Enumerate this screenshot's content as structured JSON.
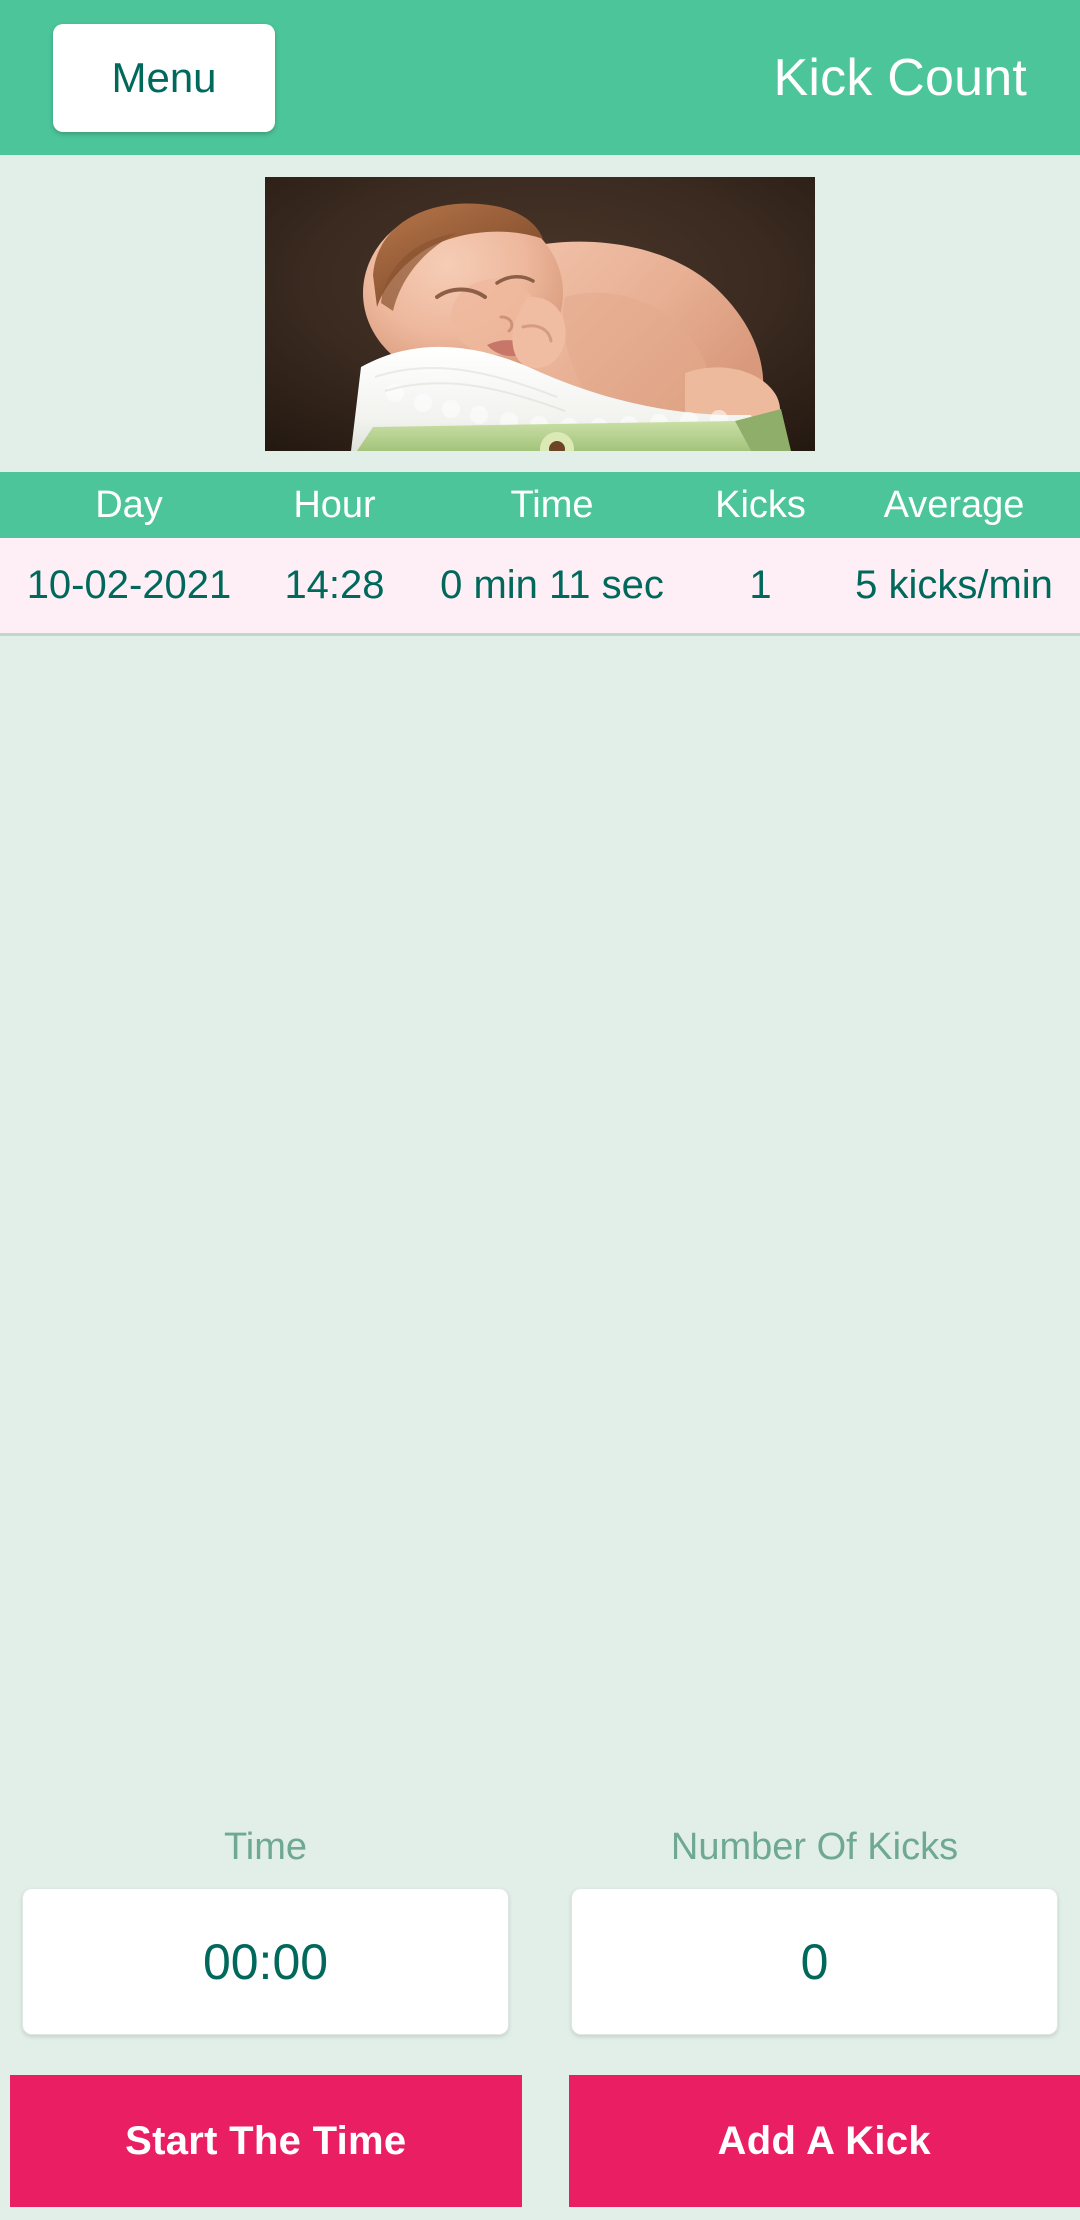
{
  "appbar": {
    "menu_label": "Menu",
    "title": "Kick Count",
    "background_color": "#4cc59a",
    "menu_text_color": "#00695c"
  },
  "photo": {
    "alt": "sleeping-newborn-baby-in-green-box-with-white-lace-blanket",
    "icon_name": "baby-photo"
  },
  "table": {
    "columns": [
      "Day",
      "Hour",
      "Time",
      "Kicks",
      "Average"
    ],
    "rows": [
      {
        "day": "10-02-2021",
        "hour": "14:28",
        "time": "0 min 11 sec",
        "kicks": "1",
        "average": "5 kicks/min"
      }
    ],
    "header_background": "#4cc59a",
    "row_background": "#fdeff5",
    "row_text_color": "#00695c"
  },
  "controls": {
    "time_label": "Time",
    "time_value": "00:00",
    "kicks_label": "Number Of Kicks",
    "kicks_value": "0",
    "label_color": "#6fa893",
    "value_color": "#00695c"
  },
  "actions": {
    "start_label": "Start The Time",
    "add_kick_label": "Add A Kick",
    "button_color": "#e91e63"
  },
  "theme": {
    "body_background": "#e2efe9",
    "accent_green": "#4cc59a",
    "accent_pink": "#e91e63"
  }
}
